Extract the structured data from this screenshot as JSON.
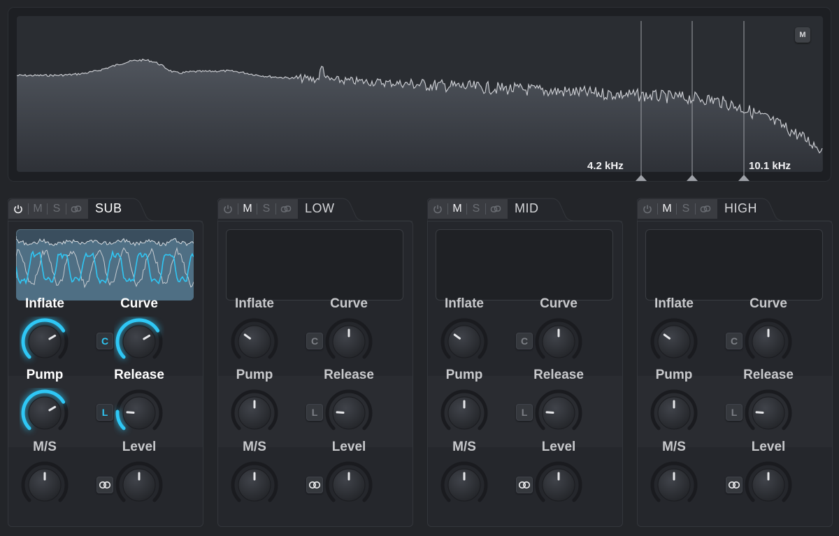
{
  "analyzer": {
    "monitor_label": "M",
    "crossovers": [
      {
        "label": "4.2 kHz"
      },
      {
        "label": ""
      },
      {
        "label": "10.1 kHz"
      }
    ]
  },
  "colors": {
    "accent": "#2fc7f5",
    "text": "#e8e8ea"
  },
  "band_tab_icons": {
    "power": "power-icon",
    "link": "link-icon"
  },
  "tab_labels": {
    "mute": "M",
    "solo": "S"
  },
  "bands": [
    {
      "id": "sub",
      "name": "SUB",
      "active": true,
      "inflate": {
        "label": "Inflate",
        "value": 0.72
      },
      "curve": {
        "label": "Curve",
        "value": 0.72
      },
      "clip_button": "C",
      "pump": {
        "label": "Pump",
        "value": 0.72
      },
      "release": {
        "label": "Release",
        "value": 0.18
      },
      "lookahead_button": "L",
      "ms": {
        "label": "M/S",
        "value": 0.5
      },
      "level": {
        "label": "Level",
        "value": 0.5
      },
      "stereo_icon": "stereo-link-icon"
    },
    {
      "id": "low",
      "name": "LOW",
      "active": false,
      "inflate": {
        "label": "Inflate",
        "value": 0.3
      },
      "curve": {
        "label": "Curve",
        "value": 0.5
      },
      "clip_button": "C",
      "pump": {
        "label": "Pump",
        "value": 0.5
      },
      "release": {
        "label": "Release",
        "value": 0.18
      },
      "lookahead_button": "L",
      "ms": {
        "label": "M/S",
        "value": 0.5
      },
      "level": {
        "label": "Level",
        "value": 0.5
      },
      "stereo_icon": "stereo-link-icon"
    },
    {
      "id": "mid",
      "name": "MID",
      "active": false,
      "inflate": {
        "label": "Inflate",
        "value": 0.3
      },
      "curve": {
        "label": "Curve",
        "value": 0.5
      },
      "clip_button": "C",
      "pump": {
        "label": "Pump",
        "value": 0.5
      },
      "release": {
        "label": "Release",
        "value": 0.18
      },
      "lookahead_button": "L",
      "ms": {
        "label": "M/S",
        "value": 0.5
      },
      "level": {
        "label": "Level",
        "value": 0.5
      },
      "stereo_icon": "stereo-link-icon"
    },
    {
      "id": "high",
      "name": "HIGH",
      "active": false,
      "inflate": {
        "label": "Inflate",
        "value": 0.3
      },
      "curve": {
        "label": "Curve",
        "value": 0.5
      },
      "clip_button": "C",
      "pump": {
        "label": "Pump",
        "value": 0.5
      },
      "release": {
        "label": "Release",
        "value": 0.18
      },
      "lookahead_button": "L",
      "ms": {
        "label": "M/S",
        "value": 0.5
      },
      "level": {
        "label": "Level",
        "value": 0.5
      },
      "stereo_icon": "stereo-link-icon"
    }
  ]
}
